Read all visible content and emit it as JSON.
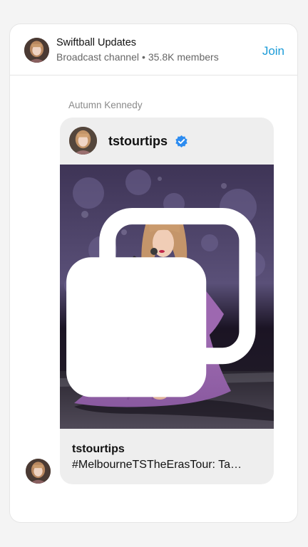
{
  "channel": {
    "name": "Swiftball Updates",
    "type": "Broadcast channel",
    "separator": "•",
    "members": "35.8K members",
    "join_label": "Join"
  },
  "message": {
    "sender": "Autumn Kennedy",
    "post": {
      "username": "tstourtips",
      "verified": true,
      "caption_user": "tstourtips",
      "caption_text": "#MelbourneTSTheErasTour: Ta…",
      "image_description_icon": "multiple-images-icon"
    }
  },
  "colors": {
    "accent": "#1a9bd8",
    "verified_badge": "#2d8cf0",
    "bubble_bg": "#eeeeee"
  }
}
